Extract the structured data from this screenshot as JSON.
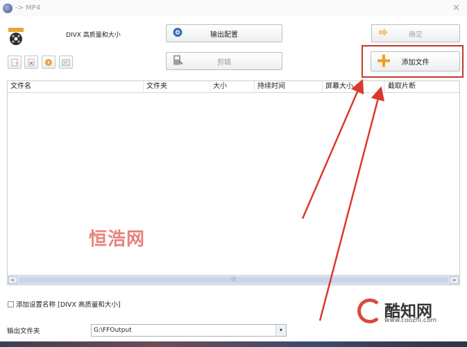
{
  "window": {
    "title": "-> MP4",
    "close_glyph": "×"
  },
  "preset": {
    "label": "DIVX 高质量和大小",
    "icon": "film-reel-icon"
  },
  "buttons": {
    "output_config": "输出配置",
    "clip": "剪辑",
    "ok": "确定",
    "add_file": "添加文件"
  },
  "toolbar": {
    "icons": [
      "add-item-icon",
      "remove-item-icon",
      "play-icon",
      "info-icon"
    ]
  },
  "table": {
    "columns": [
      "文件名",
      "文件夹",
      "大小",
      "持续时间",
      "屏幕大小",
      "截取片断"
    ]
  },
  "scrollbar": {
    "left": "<",
    "right": ">",
    "grip": "|||"
  },
  "bottom": {
    "checkbox_label": "添加设置名称 [DIVX 高质量和大小]",
    "output_folder_label": "输出文件夹",
    "output_folder_value": "G:\\FFOutput",
    "dropdown_glyph": "▾"
  },
  "watermarks": {
    "center": "恒浩网",
    "logo_text": "酷知网",
    "logo_url": "www.coozhi.com"
  },
  "colors": {
    "highlight_red": "#c0392b",
    "arrow_red": "#d9392c",
    "add_icon_orange": "#f2a01d"
  }
}
